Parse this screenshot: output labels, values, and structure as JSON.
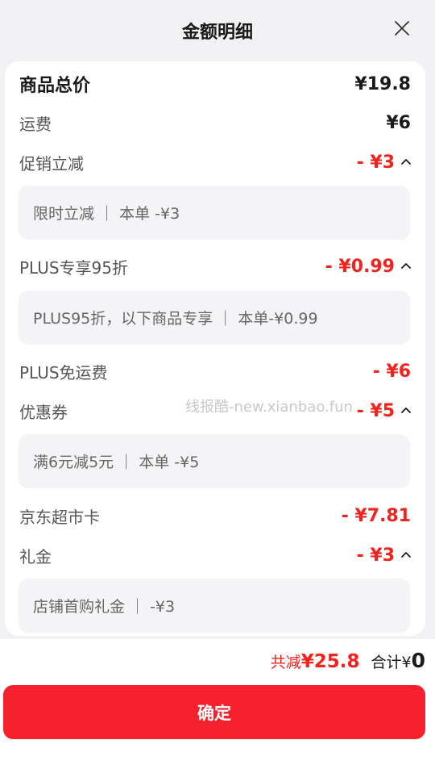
{
  "header": {
    "title": "金额明细"
  },
  "rows": {
    "total": {
      "label": "商品总价",
      "value": "¥19.8"
    },
    "shipping": {
      "label": "运费",
      "value": "¥6"
    },
    "promo": {
      "label": "促销立减",
      "value": "- ¥3",
      "detail": "限时立减 ｜ 本单 -¥3"
    },
    "plus95": {
      "label": "PLUS专享95折",
      "value": "- ¥0.99",
      "detail": "PLUS95折，以下商品专享 ｜ 本单-¥0.99"
    },
    "plus_free_ship": {
      "label": "PLUS免运费",
      "value": "- ¥6"
    },
    "coupon": {
      "label": "优惠券",
      "value": "- ¥5",
      "detail": "满6元减5元 ｜ 本单 -¥5"
    },
    "jd_card": {
      "label": "京东超市卡",
      "value": "- ¥7.81"
    },
    "gift": {
      "label": "礼金",
      "value": "- ¥3",
      "detail": "店铺首购礼金 ｜ -¥3"
    }
  },
  "watermark": "线报酷-new.xianbao.fun",
  "footer": {
    "saved_label": "共减",
    "saved_value": "¥25.8",
    "total_label": "合计",
    "total_currency": "¥",
    "total_value": "0",
    "confirm_label": "确定"
  },
  "colors": {
    "accent_red": "#f2231e",
    "button_red": "#f5222d"
  },
  "icons": {
    "close": "close-icon",
    "collapse": "chevron-up-icon"
  }
}
